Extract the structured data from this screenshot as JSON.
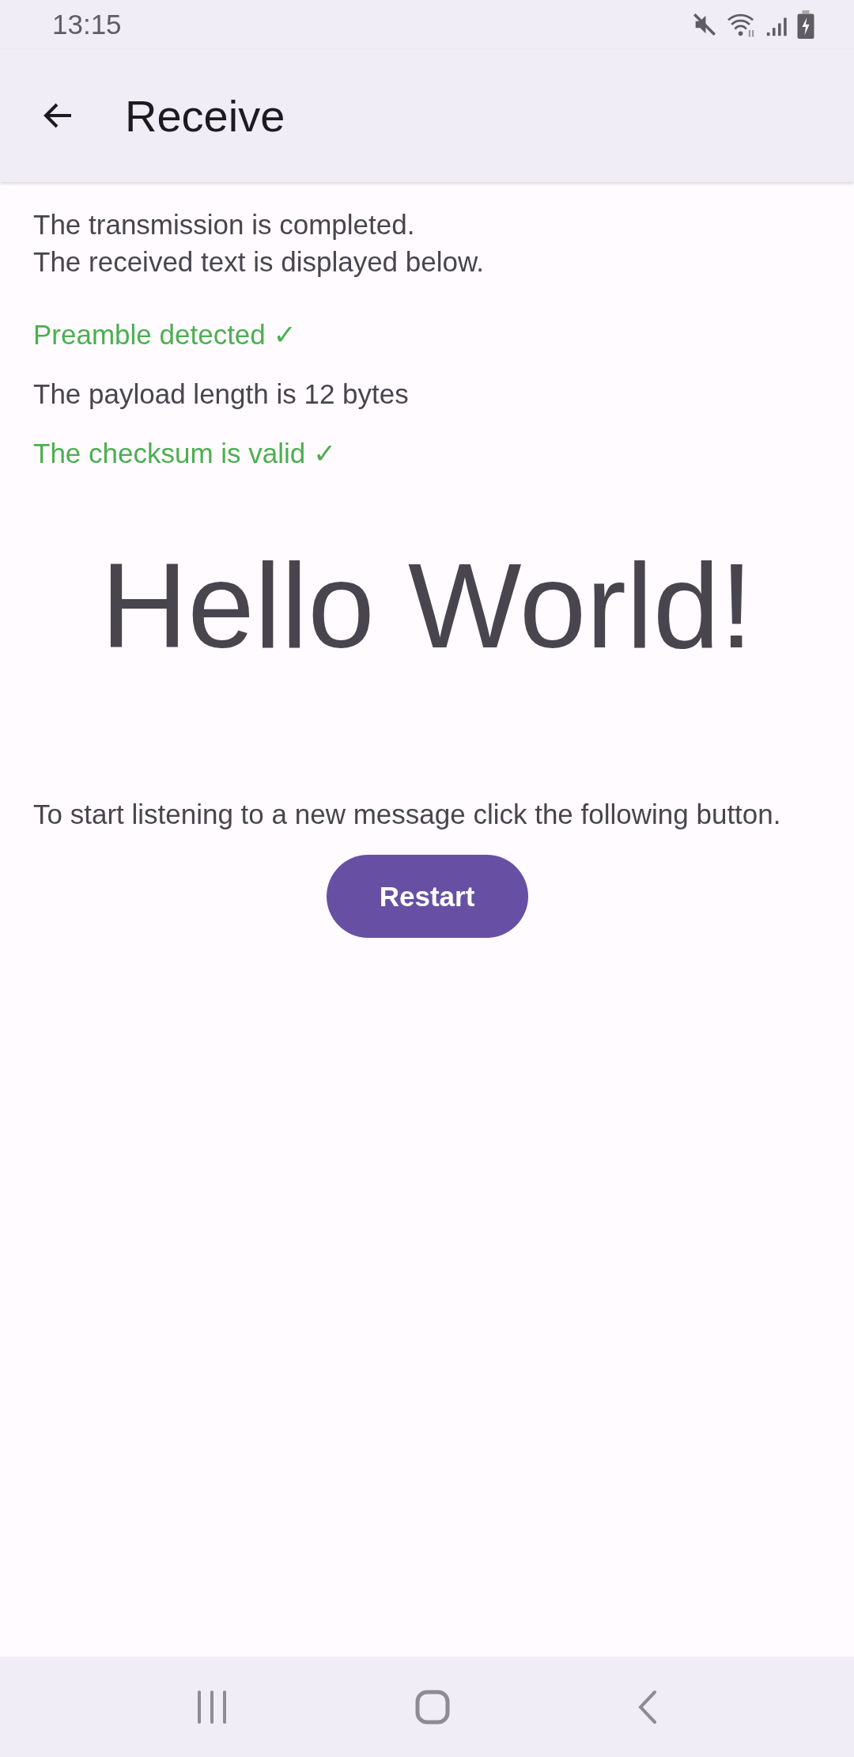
{
  "status_bar": {
    "time": "13:15"
  },
  "app_bar": {
    "title": "Receive"
  },
  "intro": [
    "The transmission is completed.",
    "The received text is displayed below."
  ],
  "checks": [
    {
      "text": "Preamble detected ✓",
      "kind": "success"
    },
    {
      "text": "The payload length is 12 bytes",
      "kind": "info"
    },
    {
      "text": "The checksum is valid ✓",
      "kind": "success"
    }
  ],
  "message": "Hello World!",
  "hint": "To start listening to a new message click the following button.",
  "restart_button": "Restart"
}
